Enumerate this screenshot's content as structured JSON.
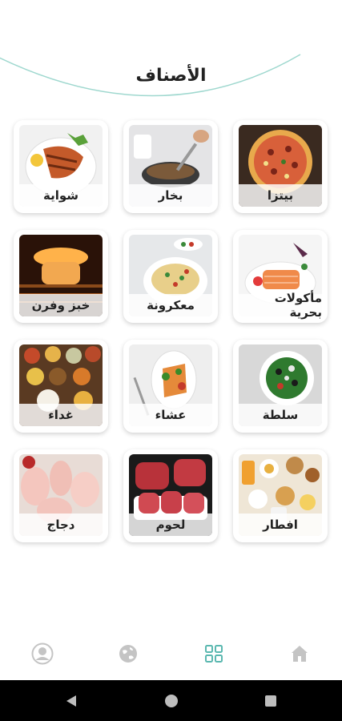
{
  "page": {
    "title": "الأصناف"
  },
  "categories": [
    {
      "label": "بيتزا",
      "icon": "pizza-photo"
    },
    {
      "label": "بخار",
      "icon": "steamed-food-photo"
    },
    {
      "label": "شواية",
      "icon": "grilled-fish-photo"
    },
    {
      "label": "مأكولات بحرية",
      "icon": "seafood-photo"
    },
    {
      "label": "معكرونة",
      "icon": "pasta-photo"
    },
    {
      "label": "خبز وفرن",
      "icon": "oven-bread-photo"
    },
    {
      "label": "سلطة",
      "icon": "salad-photo"
    },
    {
      "label": "عشاء",
      "icon": "dinner-photo"
    },
    {
      "label": "غداء",
      "icon": "lunch-photo"
    },
    {
      "label": "افطار",
      "icon": "breakfast-photo"
    },
    {
      "label": "لحوم",
      "icon": "meat-photo"
    },
    {
      "label": "دجاج",
      "icon": "chicken-photo"
    }
  ],
  "bottom_nav": [
    {
      "name": "home",
      "icon": "home-icon",
      "active": false
    },
    {
      "name": "categories",
      "icon": "grid-icon",
      "active": true
    },
    {
      "name": "explore",
      "icon": "globe-icon",
      "active": false
    },
    {
      "name": "profile",
      "icon": "user-icon",
      "active": false
    }
  ],
  "colors": {
    "accent": "#5bb8b0",
    "arc": "#9fd8cf",
    "inactive_icon": "#c4c4c4"
  }
}
